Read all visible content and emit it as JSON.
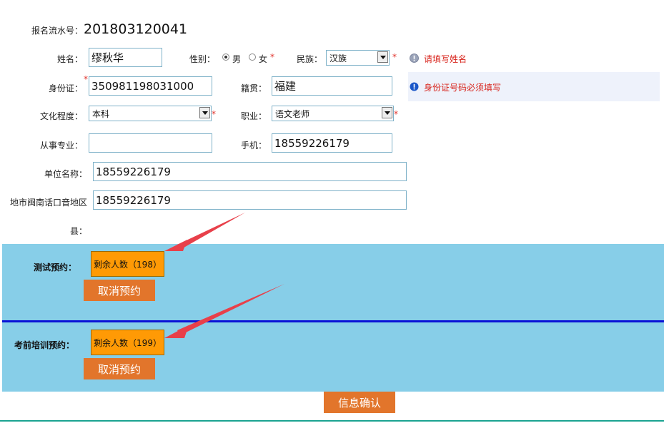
{
  "header": {
    "serial_label": "报名流水号：",
    "serial_value": "201803120041"
  },
  "form": {
    "name": {
      "label": "姓名：",
      "value": "缪秋华"
    },
    "gender": {
      "label": "性别：",
      "male": "男",
      "female": "女",
      "selected": "男"
    },
    "ethnicity": {
      "label": "民族：",
      "value": "汉族"
    },
    "id_card": {
      "label": "身份证：",
      "value": "350981198031000"
    },
    "native_place": {
      "label": "籍贯：",
      "value": "福建"
    },
    "education": {
      "label": "文化程度：",
      "value": "本科"
    },
    "occupation": {
      "label": "职业：",
      "value": "语文老师"
    },
    "major": {
      "label": "从事专业：",
      "value": ""
    },
    "mobile": {
      "label": "手机：",
      "value": "18559226179"
    },
    "employer": {
      "label": "单位名称：",
      "value": "18559226179"
    },
    "dialect_region": {
      "label": "地市闽南话口音地区",
      "value": "18559226179"
    },
    "county": {
      "label": "县："
    },
    "required_mark": "*"
  },
  "hints": {
    "name_error": "请填写姓名",
    "id_error": "身份证号码必须填写"
  },
  "test_booking": {
    "label": "测试预约：",
    "slot_label": "剩余人数（198）",
    "cancel_label": "取消预约"
  },
  "training_booking": {
    "label": "考前培训预约：",
    "slot_label": "剩余人数（199）",
    "cancel_label": "取消预约"
  },
  "confirm_label": "信息确认",
  "colors": {
    "band": "#87cee8",
    "divider": "#0a12d6",
    "slot": "#ff9a05",
    "button": "#e2752b",
    "arrow": "#e8404a",
    "error": "#d8241c"
  }
}
